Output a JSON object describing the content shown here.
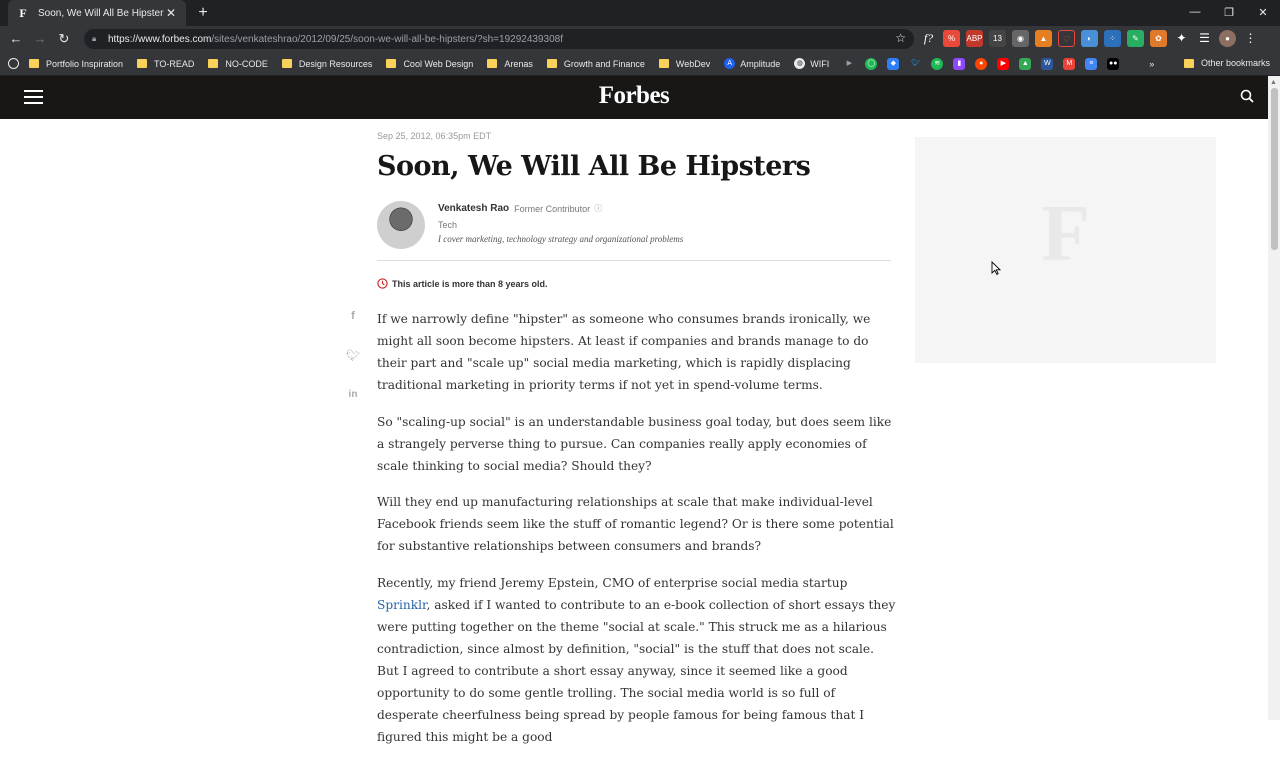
{
  "browser": {
    "tab_title": "Soon, We Will All Be Hipsters",
    "tab_favicon": "F",
    "url_host": "https://www.forbes.com",
    "url_path": "/sites/venkateshrao/2012/09/25/soon-we-will-all-be-hipsters/?sh=19292439308f",
    "bookmarks": [
      {
        "label": "Portfolio Inspiration",
        "icon": "folder-icon"
      },
      {
        "label": "TO-READ",
        "icon": "folder-icon"
      },
      {
        "label": "NO-CODE",
        "icon": "folder-icon"
      },
      {
        "label": "Design Resources",
        "icon": "folder-icon"
      },
      {
        "label": "Cool Web Design",
        "icon": "folder-icon"
      },
      {
        "label": "Arenas",
        "icon": "folder-icon"
      },
      {
        "label": "Growth and Finance",
        "icon": "folder-icon"
      },
      {
        "label": "WebDev",
        "icon": "folder-icon"
      },
      {
        "label": "Amplitude",
        "icon": "amplitude-icon"
      },
      {
        "label": "WIFI",
        "icon": "globe-icon"
      }
    ],
    "other_bookmarks": "Other bookmarks",
    "overflow": "»"
  },
  "site": {
    "logo": "Forbes"
  },
  "article": {
    "date": "Sep 25, 2012, 06:35pm EDT",
    "title": "Soon, We Will All Be Hipsters",
    "author_name": "Venkatesh Rao",
    "author_role": "Former Contributor",
    "author_category": "Tech",
    "author_bio": "I cover marketing, technology strategy and organizational problems",
    "old_notice": "This article is more than 8 years old.",
    "p1": "If we narrowly define \"hipster\" as someone who consumes brands ironically, we might all soon become hipsters. At least if companies and brands manage to do their part and \"scale up\" social media marketing, which is rapidly displacing traditional marketing in priority terms if not yet in spend-volume terms.",
    "p2": "So \"scaling-up social\" is an understandable business goal today, but does seem like a strangely perverse thing to pursue. Can companies really apply economies of scale thinking to social media? Should they?",
    "p3": "Will they end up manufacturing relationships at scale that make individual-level Facebook friends seem like the stuff of romantic legend? Or is there some potential for substantive relationships between consumers and brands?",
    "p4_before": "Recently, my friend Jeremy Epstein, CMO of enterprise social media startup ",
    "p4_link": "Sprinklr",
    "p4_after": ", asked if I wanted to contribute to an e-book collection of short essays they were putting together on the theme \"social at scale.\"  This struck me as a hilarious contradiction, since almost by definition, \"social\" is the stuff that does not scale. But I agreed to contribute a short essay anyway, since it seemed like a good opportunity to do some gentle trolling. The social media world is so full of desperate cheerfulness being spread by people famous for being famous that I figured this might be a good"
  },
  "ad": {
    "placeholder_letter": "F"
  }
}
